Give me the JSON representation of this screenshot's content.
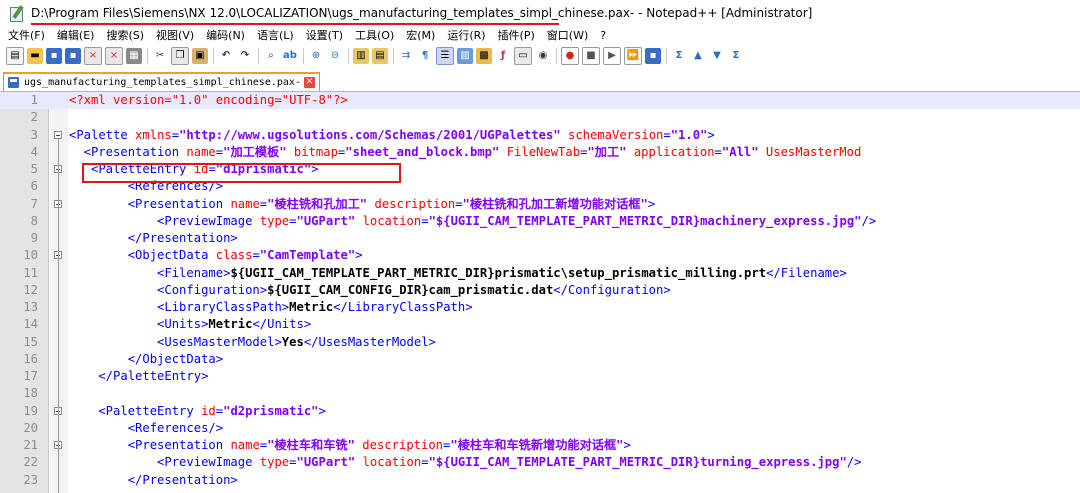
{
  "window": {
    "title": "D:\\Program Files\\Siemens\\NX 12.0\\LOCALIZATION\\ugs_manufacturing_templates_simpl_chinese.pax- - Notepad++ [Administrator]"
  },
  "menu": [
    "文件(F)",
    "编辑(E)",
    "搜索(S)",
    "视图(V)",
    "编码(N)",
    "语言(L)",
    "设置(T)",
    "工具(O)",
    "宏(M)",
    "运行(R)",
    "插件(P)",
    "窗口(W)",
    "?"
  ],
  "tab": {
    "label": "ugs_manufacturing_templates_simpl_chinese.pax-",
    "close": "✕"
  },
  "colors": {
    "tag": "#0000ff",
    "attr": "#ff0000",
    "value": "#8000ff",
    "text": "#000000",
    "gutter": "#e4e4e4",
    "highlight": "#e0161d"
  },
  "lines": [
    {
      "n": "1",
      "p": [
        "",
        "<?xml version=\"1.0\" encoding=\"UTF-8\"?>"
      ]
    },
    {
      "n": "2",
      "p": [
        ""
      ]
    },
    {
      "n": "3",
      "p": [
        "<Palette ",
        "xmlns",
        "=",
        "\"http://www.ugsolutions.com/Schemas/2001/UGPalettes\"",
        " schemaVersion",
        "=",
        "\"1.0\"",
        ">"
      ]
    },
    {
      "n": "4",
      "p": [
        "  <Presentation ",
        "name",
        "=",
        "\"加工模板\"",
        " bitmap",
        "=",
        "\"sheet_and_block.bmp\"",
        " FileNewTab",
        "=",
        "\"加工\"",
        " application",
        "=",
        "\"All\"",
        " UsesMasterMod"
      ]
    },
    {
      "n": "5",
      "p": [
        "   <PaletteEntry ",
        "id",
        "=",
        "\"d1prismatic\"",
        ">"
      ]
    },
    {
      "n": "6",
      "p": [
        "        <References/>"
      ]
    },
    {
      "n": "7",
      "p": [
        "        <Presentation ",
        "name",
        "=",
        "\"棱柱铣和孔加工\"",
        " description",
        "=",
        "\"棱柱铣和孔加工新增功能对话框\"",
        ">"
      ]
    },
    {
      "n": "8",
      "p": [
        "            <PreviewImage ",
        "type",
        "=",
        "\"UGPart\"",
        " location",
        "=",
        "\"${UGII_CAM_TEMPLATE_PART_METRIC_DIR}machinery_express.jpg\"",
        "/>"
      ]
    },
    {
      "n": "9",
      "p": [
        "        </Presentation>"
      ]
    },
    {
      "n": "10",
      "p": [
        "        <ObjectData ",
        "class",
        "=",
        "\"CamTemplate\"",
        ">"
      ]
    },
    {
      "n": "11",
      "p": [
        "            <Filename>",
        "${UGII_CAM_TEMPLATE_PART_METRIC_DIR}prismatic\\setup_prismatic_milling.prt",
        "</Filename>"
      ]
    },
    {
      "n": "12",
      "p": [
        "            <Configuration>",
        "${UGII_CAM_CONFIG_DIR}cam_prismatic.dat",
        "</Configuration>"
      ]
    },
    {
      "n": "13",
      "p": [
        "            <LibraryClassPath>",
        "Metric",
        "</LibraryClassPath>"
      ]
    },
    {
      "n": "14",
      "p": [
        "            <Units>",
        "Metric",
        "</Units>"
      ]
    },
    {
      "n": "15",
      "p": [
        "            <UsesMasterModel>",
        "Yes",
        "</UsesMasterModel>"
      ]
    },
    {
      "n": "16",
      "p": [
        "        </ObjectData>"
      ]
    },
    {
      "n": "17",
      "p": [
        "    </PaletteEntry>"
      ]
    },
    {
      "n": "18",
      "p": [
        ""
      ]
    },
    {
      "n": "19",
      "p": [
        "    <PaletteEntry ",
        "id",
        "=",
        "\"d2prismatic\"",
        ">"
      ]
    },
    {
      "n": "20",
      "p": [
        "        <References/>"
      ]
    },
    {
      "n": "21",
      "p": [
        "        <Presentation ",
        "name",
        "=",
        "\"棱柱车和车铣\"",
        " description",
        "=",
        "\"棱柱车和车铣新增功能对话框\"",
        ">"
      ]
    },
    {
      "n": "22",
      "p": [
        "            <PreviewImage ",
        "type",
        "=",
        "\"UGPart\"",
        " location",
        "=",
        "\"${UGII_CAM_TEMPLATE_PART_METRIC_DIR}turning_express.jpg\"",
        "/>"
      ]
    },
    {
      "n": "23",
      "p": [
        "        </Presentation>"
      ]
    }
  ]
}
